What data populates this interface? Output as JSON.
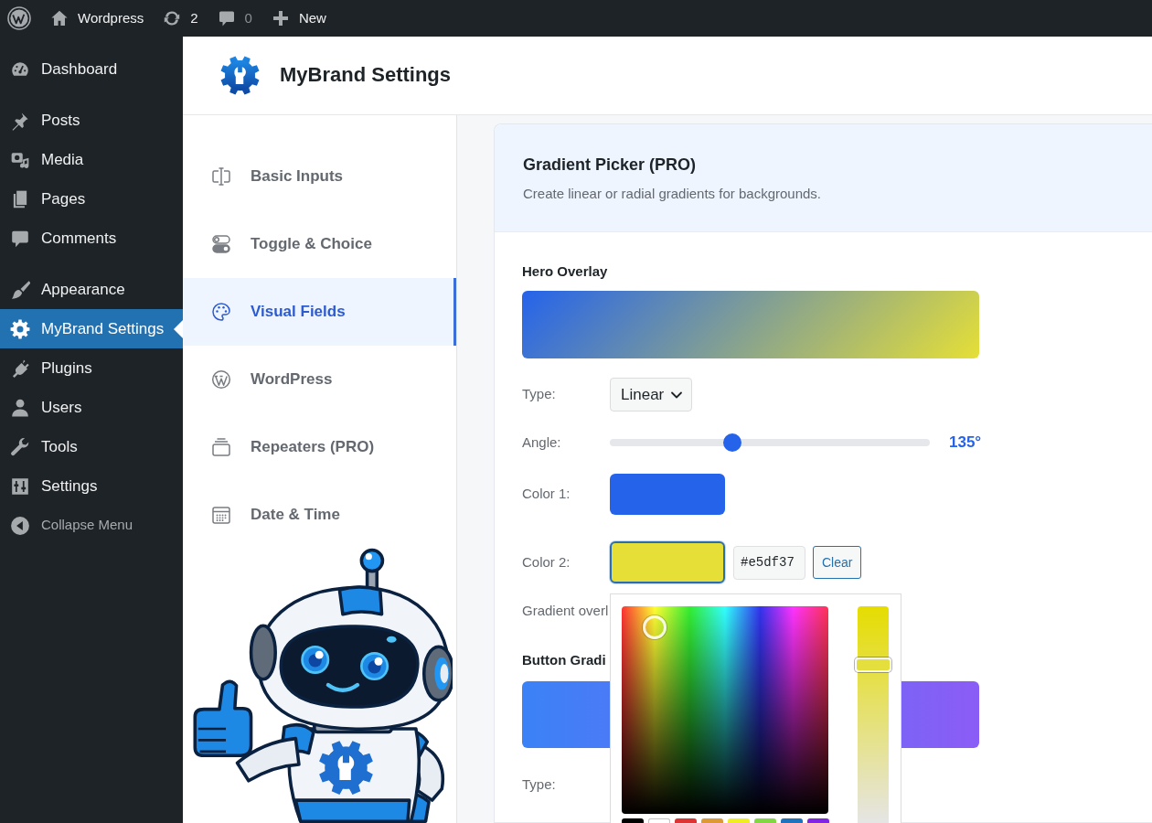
{
  "admin_bar": {
    "items": [
      {
        "label": "Wordpress",
        "muted": false
      },
      {
        "label": "2",
        "muted": false
      },
      {
        "label": "0",
        "muted": true
      },
      {
        "label": "New",
        "muted": false
      }
    ]
  },
  "sidebar": {
    "groups": [
      [
        {
          "label": "Dashboard",
          "selected": false
        }
      ],
      [
        {
          "label": "Posts",
          "selected": false
        },
        {
          "label": "Media",
          "selected": false
        },
        {
          "label": "Pages",
          "selected": false
        },
        {
          "label": "Comments",
          "selected": false
        }
      ],
      [
        {
          "label": "Appearance",
          "selected": false
        },
        {
          "label": "MyBrand Settings",
          "selected": true
        },
        {
          "label": "Plugins",
          "selected": false
        },
        {
          "label": "Users",
          "selected": false
        },
        {
          "label": "Tools",
          "selected": false
        },
        {
          "label": "Settings",
          "selected": false
        }
      ]
    ],
    "collapse": {
      "label": "Collapse Menu"
    }
  },
  "page_header": {
    "title": "MyBrand Settings"
  },
  "tabs": [
    {
      "label": "Basic Inputs",
      "selected": false
    },
    {
      "label": "Toggle & Choice",
      "selected": false
    },
    {
      "label": "Visual Fields",
      "selected": true
    },
    {
      "label": "WordPress",
      "selected": false
    },
    {
      "label": "Repeaters (PRO)",
      "selected": false
    },
    {
      "label": "Date & Time",
      "selected": false
    }
  ],
  "section": {
    "title": "Gradient Picker (PRO)",
    "description": "Create linear or radial gradients for backgrounds."
  },
  "hero_overlay": {
    "title": "Hero Overlay",
    "type": {
      "label": "Type:",
      "value": "Linear"
    },
    "angle": {
      "label": "Angle:",
      "level": 0.375,
      "reading": "135°"
    },
    "color_1": {
      "label": "Color 1:",
      "color": "#2563eb",
      "active": false
    },
    "color_2": {
      "label": "Color 2:",
      "color": "#e5df37",
      "active": true,
      "hex_value": "#e5df37",
      "clear_button": "Clear"
    },
    "note": "Gradient overl"
  },
  "color_picker": {
    "saturation": {
      "level": 0.73
    },
    "palette": [
      {
        "color": "#000000"
      },
      {
        "color": "#ffffff"
      },
      {
        "color": "#dd3333"
      },
      {
        "color": "#dd9933"
      },
      {
        "color": "#eeee22"
      },
      {
        "color": "#81d742"
      },
      {
        "color": "#1e73be"
      },
      {
        "color": "#8224e3"
      }
    ]
  },
  "button_gradient": {
    "title": "Button Gradi",
    "stops": [
      {
        "color": "#3b82f6"
      },
      {
        "color": "#8b5cf6"
      }
    ],
    "type_label": "Type:"
  }
}
